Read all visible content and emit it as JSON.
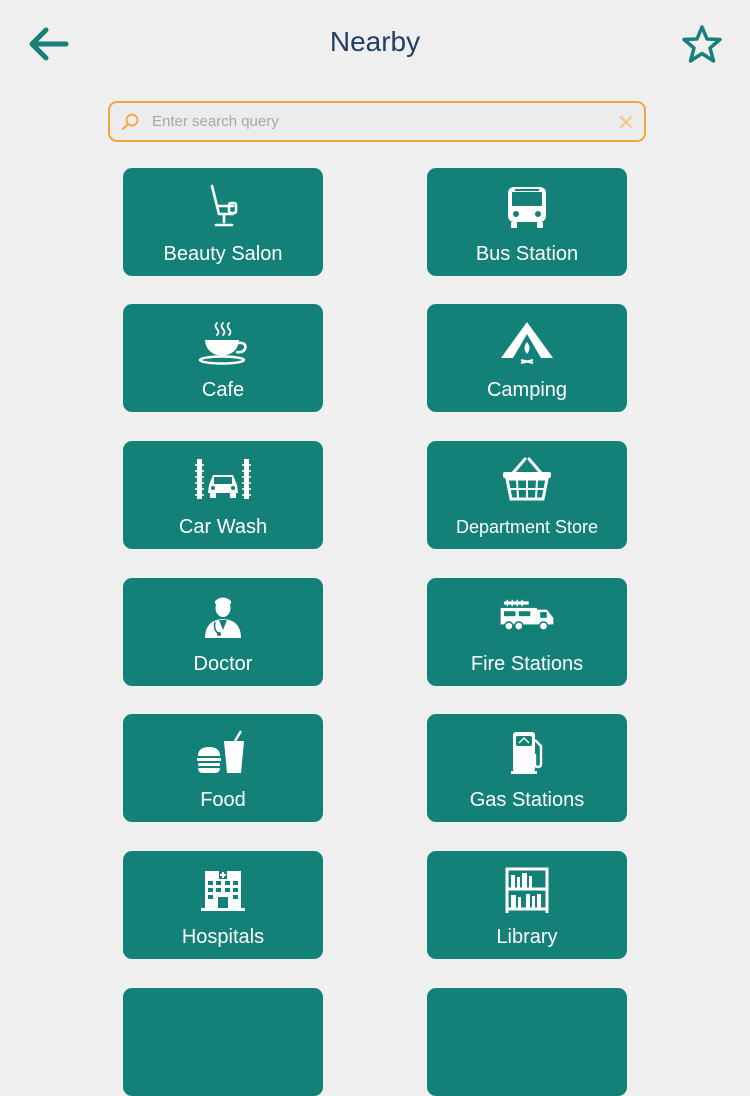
{
  "header": {
    "title": "Nearby"
  },
  "search": {
    "placeholder": "Enter search query",
    "value": ""
  },
  "colors": {
    "tile": "#138178",
    "accent": "#1a7f78",
    "title": "#1f3f63",
    "search_border": "#f0a63a",
    "background": "#efefef"
  },
  "categories": [
    {
      "label": "Beauty Salon",
      "icon": "salon-chair-icon"
    },
    {
      "label": "Bus Station",
      "icon": "bus-icon"
    },
    {
      "label": "Cafe",
      "icon": "coffee-cup-icon"
    },
    {
      "label": "Camping",
      "icon": "tent-icon"
    },
    {
      "label": "Car Wash",
      "icon": "car-wash-icon"
    },
    {
      "label": "Department Store",
      "icon": "shopping-basket-icon"
    },
    {
      "label": "Doctor",
      "icon": "doctor-icon"
    },
    {
      "label": "Fire Stations",
      "icon": "fire-truck-icon"
    },
    {
      "label": "Food",
      "icon": "burger-drink-icon"
    },
    {
      "label": "Gas Stations",
      "icon": "fuel-pump-icon"
    },
    {
      "label": "Hospitals",
      "icon": "hospital-building-icon"
    },
    {
      "label": "Library",
      "icon": "bookshelf-icon"
    }
  ]
}
